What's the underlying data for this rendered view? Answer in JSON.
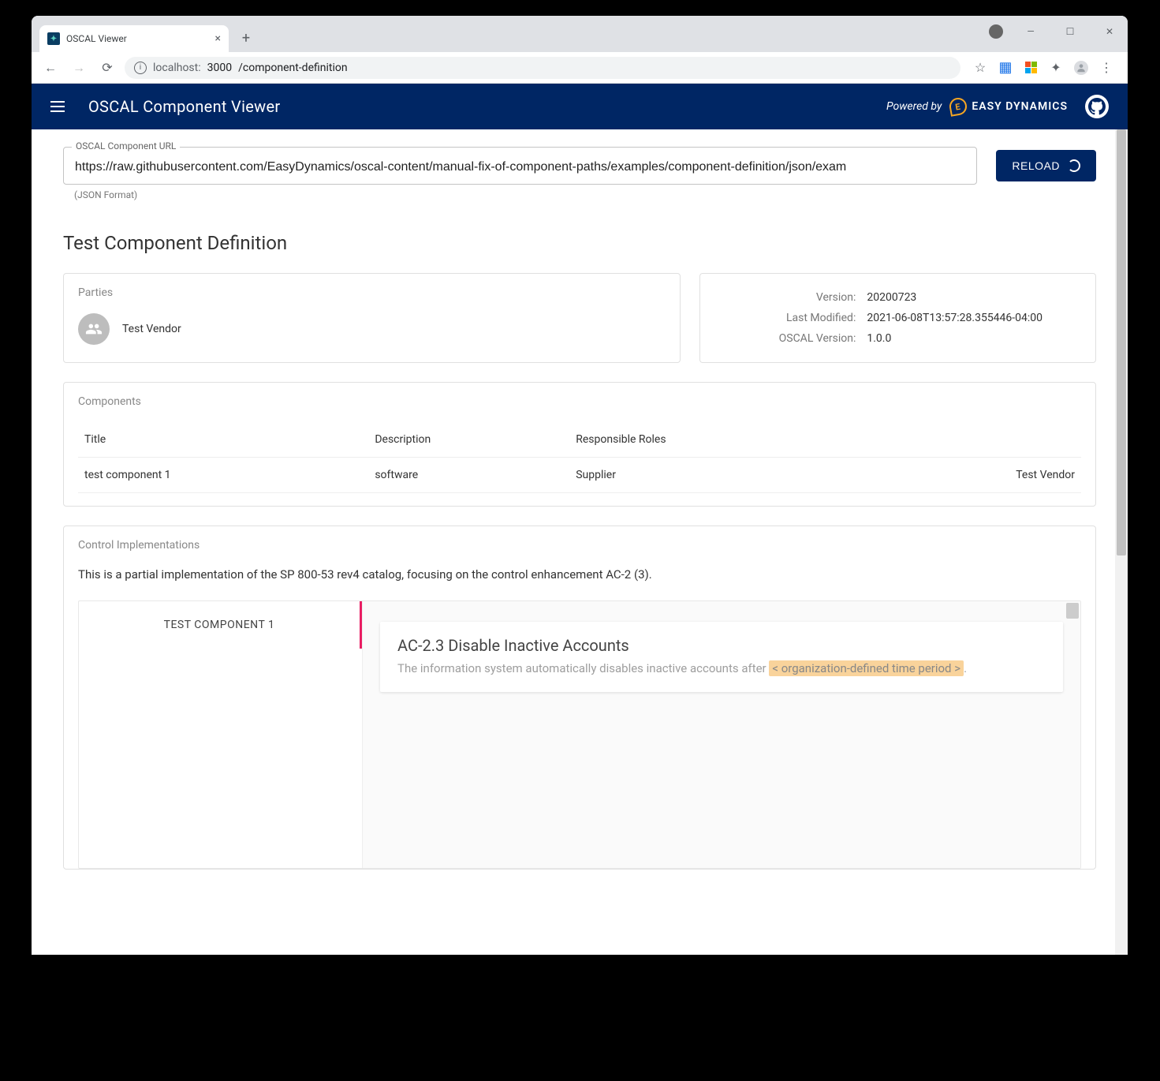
{
  "browser": {
    "tab_title": "OSCAL Viewer",
    "url_host": "localhost:",
    "url_port": "3000",
    "url_path": "/component-definition"
  },
  "header": {
    "title": "OSCAL Component Viewer",
    "powered_by": "Powered by",
    "brand": "EASY DYNAMICS"
  },
  "url_field": {
    "label": "OSCAL Component URL",
    "value": "https://raw.githubusercontent.com/EasyDynamics/oscal-content/manual-fix-of-component-paths/examples/component-definition/json/exam",
    "helper": "(JSON Format)"
  },
  "reload_label": "RELOAD",
  "page_title": "Test Component Definition",
  "parties": {
    "label": "Parties",
    "items": [
      {
        "name": "Test Vendor"
      }
    ]
  },
  "metadata": {
    "version_label": "Version:",
    "version": "20200723",
    "modified_label": "Last Modified:",
    "modified": "2021-06-08T13:57:28.355446-04:00",
    "oscal_label": "OSCAL Version:",
    "oscal": "1.0.0"
  },
  "components": {
    "label": "Components",
    "headers": {
      "title": "Title",
      "description": "Description",
      "roles": "Responsible Roles"
    },
    "rows": [
      {
        "title": "test component 1",
        "description": "software",
        "role": "Supplier",
        "vendor": "Test Vendor"
      }
    ]
  },
  "implementations": {
    "label": "Control Implementations",
    "description": "This is a partial implementation of the SP 800-53 rev4 catalog, focusing on the control enhancement AC-2 (3).",
    "tab": "TEST COMPONENT 1",
    "requirement": {
      "title": "AC-2.3 Disable Inactive Accounts",
      "desc_prefix": "The information system automatically disables inactive accounts after ",
      "param": "< organization-defined time period >",
      "desc_suffix": "."
    }
  }
}
